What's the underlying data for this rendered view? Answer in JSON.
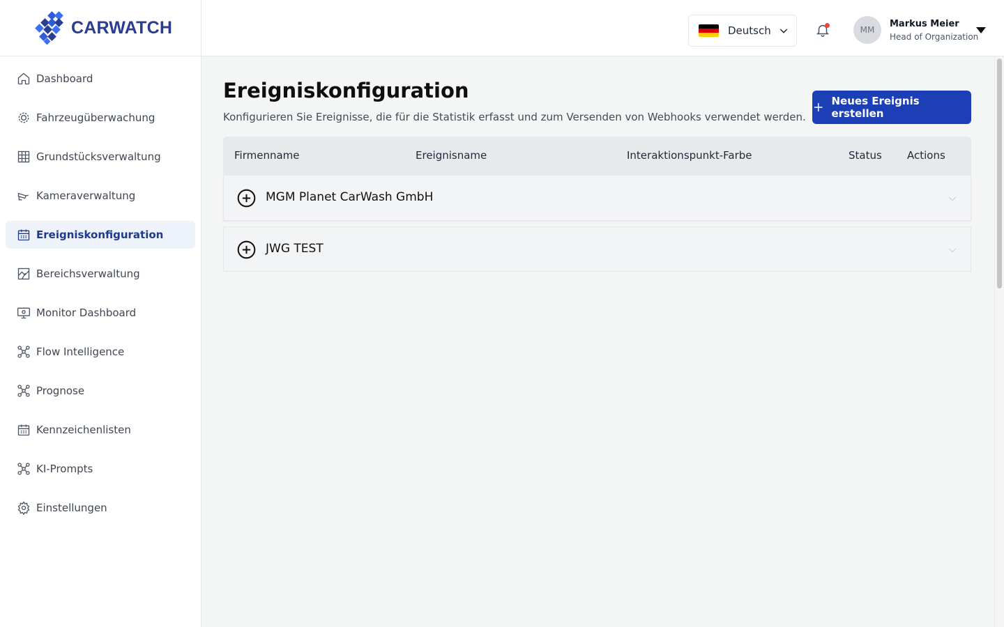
{
  "brand": {
    "name": "CARWATCH",
    "color": "#2b3d8f"
  },
  "sidebar": {
    "items": [
      {
        "label": "Dashboard",
        "icon": "home-icon",
        "active": false
      },
      {
        "label": "Fahrzeugüberwachung",
        "icon": "vehicle-monitor-icon",
        "active": false
      },
      {
        "label": "Grundstücksverwaltung",
        "icon": "property-grid-icon",
        "active": false
      },
      {
        "label": "Kameraverwaltung",
        "icon": "camera-icon",
        "active": false
      },
      {
        "label": "Ereigniskonfiguration",
        "icon": "calendar-icon",
        "active": true
      },
      {
        "label": "Bereichsverwaltung",
        "icon": "area-map-icon",
        "active": false
      },
      {
        "label": "Monitor Dashboard",
        "icon": "monitor-icon",
        "active": false
      },
      {
        "label": "Flow Intelligence",
        "icon": "network-icon",
        "active": false
      },
      {
        "label": "Prognose",
        "icon": "network-icon",
        "active": false
      },
      {
        "label": "Kennzeichenlisten",
        "icon": "calendar-icon",
        "active": false
      },
      {
        "label": "KI-Prompts",
        "icon": "network-icon",
        "active": false
      },
      {
        "label": "Einstellungen",
        "icon": "gear-icon",
        "active": false
      }
    ]
  },
  "header": {
    "language": {
      "label": "Deutsch",
      "flag": "de-flag-icon"
    },
    "notifications": {
      "has_unread": true,
      "dot_color": "#ef4444"
    },
    "user": {
      "initials": "MM",
      "name": "Markus Meier",
      "role": "Head of Organization"
    }
  },
  "page": {
    "title": "Ereigniskonfiguration",
    "subtitle": "Konfigurieren Sie Ereignisse, die für die Statistik erfasst und zum Versenden von Webhooks verwendet werden.",
    "new_button_label": "Neues Ereignis erstellen",
    "accent_color": "#1d3fb5"
  },
  "table": {
    "columns": [
      "Firmenname",
      "Ereignisname",
      "Interaktionspunkt-Farbe",
      "Status",
      "Actions"
    ],
    "groups": [
      {
        "name": "MGM Planet CarWash GmbH",
        "expanded": false
      },
      {
        "name": "JWG TEST",
        "expanded": false
      }
    ]
  }
}
